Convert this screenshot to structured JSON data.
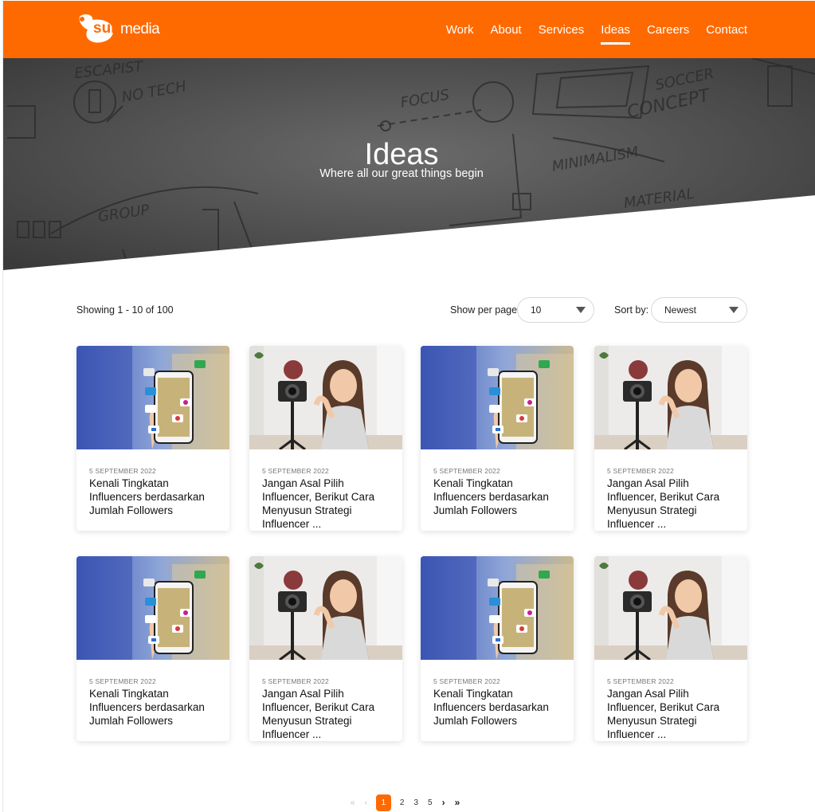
{
  "brand": {
    "suit": "suit",
    "media": "media",
    "accent": "#ff6a00"
  },
  "nav": {
    "items": [
      {
        "label": "Work"
      },
      {
        "label": "About"
      },
      {
        "label": "Services"
      },
      {
        "label": "Ideas",
        "active": true
      },
      {
        "label": "Careers"
      },
      {
        "label": "Contact"
      }
    ]
  },
  "hero": {
    "title": "Ideas",
    "subtitle": "Where all our great things begin",
    "sketch_words": [
      "ESCAPIST",
      "NO TECH",
      "FOCUS",
      "SOCCER",
      "CONCEPT",
      "MINIMALISM",
      "GROUP",
      "MATERIAL"
    ]
  },
  "toolbar": {
    "showing": "Showing 1 - 10 of 100",
    "perpage_label": "Show per page:",
    "perpage_value": "10",
    "sort_label": "Sort by:",
    "sort_value": "Newest"
  },
  "cards": [
    {
      "date": "5 SEPTEMBER 2022",
      "title": "Kenali Tingkatan Influencers berdasarkan Jumlah Followers",
      "image": "phone-social-icons"
    },
    {
      "date": "5 SEPTEMBER 2022",
      "title": "Jangan Asal Pilih Influencer, Berikut Cara Menyusun Strategi Influencer ...",
      "image": "woman-vlogging-camera"
    },
    {
      "date": "5 SEPTEMBER 2022",
      "title": "Kenali Tingkatan Influencers berdasarkan Jumlah Followers",
      "image": "phone-social-icons"
    },
    {
      "date": "5 SEPTEMBER 2022",
      "title": "Jangan Asal Pilih Influencer, Berikut Cara Menyusun Strategi Influencer ...",
      "image": "woman-vlogging-camera"
    },
    {
      "date": "5 SEPTEMBER 2022",
      "title": "Kenali Tingkatan Influencers berdasarkan Jumlah Followers",
      "image": "phone-social-icons"
    },
    {
      "date": "5 SEPTEMBER 2022",
      "title": "Jangan Asal Pilih Influencer, Berikut Cara Menyusun Strategi Influencer ...",
      "image": "woman-vlogging-camera"
    },
    {
      "date": "5 SEPTEMBER 2022",
      "title": "Kenali Tingkatan Influencers berdasarkan Jumlah Followers",
      "image": "phone-social-icons"
    },
    {
      "date": "5 SEPTEMBER 2022",
      "title": "Jangan Asal Pilih Influencer, Berikut Cara Menyusun Strategi Influencer ...",
      "image": "woman-vlogging-camera"
    }
  ],
  "pagination": {
    "first": "«",
    "prev": "‹",
    "pages": [
      "1",
      "2",
      "3",
      "5"
    ],
    "current": "1",
    "next": "›",
    "last": "»"
  }
}
